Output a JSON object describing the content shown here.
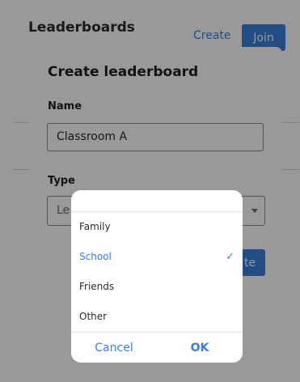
{
  "header": {
    "title": "Leaderboards",
    "create_label": "Create",
    "join_label": "Join"
  },
  "dialog": {
    "title": "Create leaderboard",
    "name_label": "Name",
    "name_value": "Classroom A",
    "type_label": "Type",
    "type_placeholder": "Le",
    "submit_label": "te"
  },
  "picker": {
    "options": [
      {
        "label": "Family",
        "selected": false
      },
      {
        "label": "School",
        "selected": true
      },
      {
        "label": "Friends",
        "selected": false
      },
      {
        "label": "Other",
        "selected": false
      }
    ],
    "check_glyph": "✓",
    "cancel_label": "Cancel",
    "ok_label": "OK"
  },
  "colors": {
    "accent": "#3b7ddd",
    "overlay": "rgba(0,0,0,0.4)"
  }
}
